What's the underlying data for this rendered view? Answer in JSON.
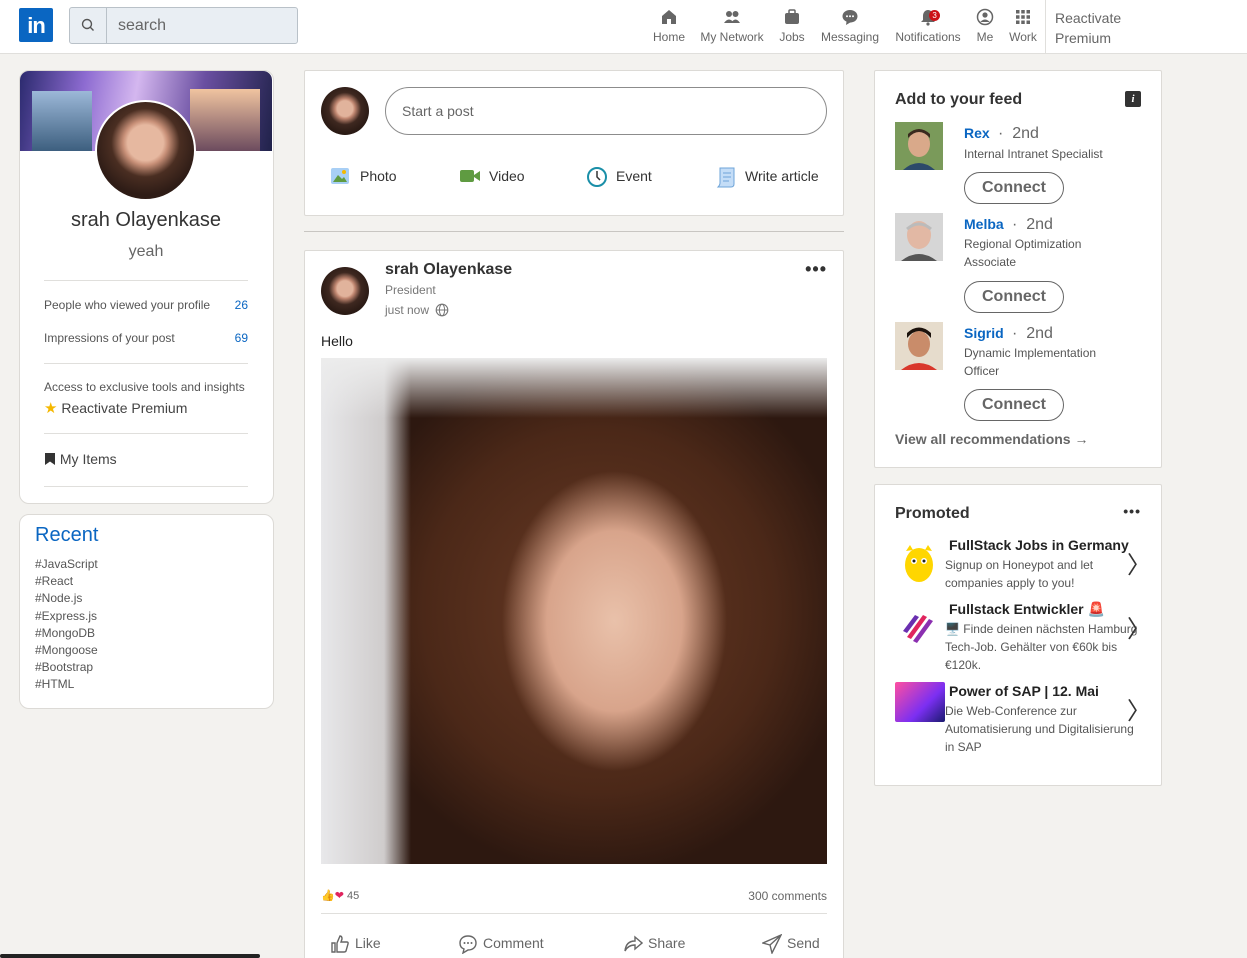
{
  "header": {
    "logo": "in",
    "search_placeholder": "search",
    "nav": [
      {
        "label": "Home",
        "icon": "home-icon"
      },
      {
        "label": "My Network",
        "icon": "network-icon"
      },
      {
        "label": "Jobs",
        "icon": "briefcase-icon"
      },
      {
        "label": "Messaging",
        "icon": "chat-icon"
      },
      {
        "label": "Notifications",
        "icon": "bell-icon",
        "badge": "3"
      },
      {
        "label": "Me",
        "icon": "user-icon"
      },
      {
        "label": "Work",
        "icon": "grid-icon"
      }
    ],
    "premium_line1": "Reactivate",
    "premium_line2": "Premium"
  },
  "profile": {
    "name": "srah Olayenkase",
    "headline": "yeah",
    "viewed_label": "People who viewed your profile",
    "viewed_value": "26",
    "impressions_label": "Impressions of your post",
    "impressions_value": "69",
    "access_text": "Access to exclusive tools and insights",
    "premium_cta": "Reactivate Premium",
    "my_items": "My Items"
  },
  "recent": {
    "title": "Recent",
    "tags": [
      "#JavaScript",
      "#React",
      "#Node.js",
      "#Express.js",
      "#MongoDB",
      "#Mongoose",
      "#Bootstrap",
      "#HTML"
    ]
  },
  "composer": {
    "placeholder": "Start a post",
    "actions": [
      {
        "label": "Photo",
        "icon": "photo-icon",
        "color": "#378fe9"
      },
      {
        "label": "Video",
        "icon": "video-icon",
        "color": "#5f9b41"
      },
      {
        "label": "Event",
        "icon": "calendar-clock-icon",
        "color": "#1a8fa8"
      },
      {
        "label": "Write article",
        "icon": "article-icon",
        "color": "#7fc15e"
      }
    ]
  },
  "post": {
    "author": "srah Olayenkase",
    "author_title": "President",
    "time": "just now",
    "more": "•••",
    "text": "Hello",
    "reaction_count": "45",
    "comments": "300 comments",
    "actions": [
      "Like",
      "Comment",
      "Share",
      "Send"
    ]
  },
  "feed_suggestions": {
    "title": "Add to your feed",
    "info_icon": "i",
    "people": [
      {
        "name": "Rex",
        "degree": "2nd",
        "title": "Internal Intranet Specialist",
        "button": "Connect"
      },
      {
        "name": "Melba",
        "degree": "2nd",
        "title": "Regional Optimization Associate",
        "button": "Connect"
      },
      {
        "name": "Sigrid",
        "degree": "2nd",
        "title": "Dynamic Implementation Officer",
        "button": "Connect"
      }
    ],
    "view_all": "View all recommendations →"
  },
  "promoted": {
    "title": "Promoted",
    "more": "•••",
    "items": [
      {
        "title": "FullStack Jobs in Germany",
        "desc": "Signup on Honeypot and let companies apply to you!"
      },
      {
        "title": "Fullstack Entwickler 🚨",
        "desc": "🖥️ Finde deinen nächsten Hamburg Tech-Job. Gehälter von €60k bis €120k."
      },
      {
        "title": "Power of SAP | 12. Mai",
        "desc": "Die Web-Conference zur Automatisierung und Digitalisierung in SAP"
      }
    ],
    "chevron": "〉"
  },
  "colors": {
    "brand": "#0a66c2",
    "background": "#f3f2ef",
    "badge": "#cc1016"
  }
}
